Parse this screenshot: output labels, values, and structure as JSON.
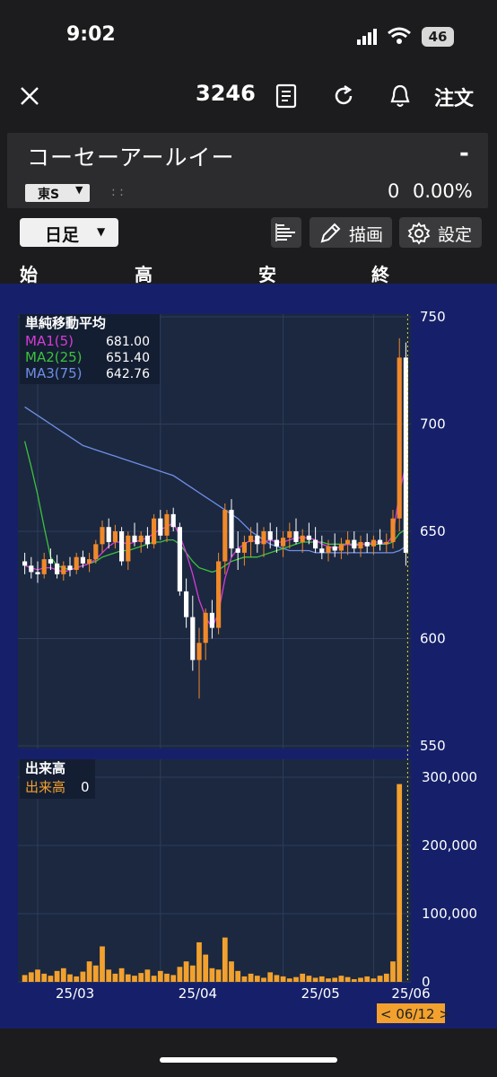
{
  "status_bar": {
    "time": "9:02",
    "battery": "46"
  },
  "nav": {
    "ticker": "3246",
    "order_label": "注文"
  },
  "header": {
    "company_name": "コーセーアールイー",
    "price": "-",
    "exchange": "東S",
    "time_placeholder": ": :",
    "change": "0",
    "change_pct": "0.00%"
  },
  "controls": {
    "period": "日足",
    "draw_label": "描画",
    "settings_label": "設定"
  },
  "ohlc_labels": {
    "open": "始",
    "high": "高",
    "low": "安",
    "close": "終"
  },
  "colors": {
    "chart_bg": "#16206a",
    "panel_bg": "#1b2840",
    "up": "#f0892a",
    "down": "#ffffff",
    "ma1": "#d63bd6",
    "ma2": "#3cc23c",
    "ma3": "#6f8fe6",
    "volume": "#f2a12e"
  },
  "chart_data": [
    {
      "type": "candlestick",
      "title": "単純移動平均",
      "legend": [
        {
          "name": "MA1(5)",
          "value": "681.00",
          "color": "#d63bd6"
        },
        {
          "name": "MA2(25)",
          "value": "651.40",
          "color": "#3cc23c"
        },
        {
          "name": "MA3(75)",
          "value": "642.76",
          "color": "#6f8fe6"
        }
      ],
      "y_ticks": [
        "750",
        "700",
        "650",
        "600",
        "550"
      ],
      "ylim": [
        550,
        750
      ],
      "x_ticks": [
        "25/03",
        "25/04",
        "25/05",
        "25/06"
      ],
      "candles": [
        [
          636,
          640,
          630,
          634
        ],
        [
          634,
          638,
          628,
          631
        ],
        [
          631,
          636,
          626,
          630
        ],
        [
          630,
          640,
          628,
          637
        ],
        [
          637,
          642,
          632,
          635
        ],
        [
          635,
          639,
          628,
          630
        ],
        [
          630,
          636,
          627,
          634
        ],
        [
          634,
          638,
          629,
          632
        ],
        [
          632,
          640,
          630,
          638
        ],
        [
          638,
          641,
          633,
          635
        ],
        [
          635,
          640,
          631,
          637
        ],
        [
          637,
          646,
          635,
          644
        ],
        [
          644,
          655,
          640,
          652
        ],
        [
          652,
          656,
          642,
          645
        ],
        [
          645,
          653,
          642,
          650
        ],
        [
          650,
          652,
          634,
          636
        ],
        [
          636,
          650,
          632,
          648
        ],
        [
          648,
          654,
          643,
          645
        ],
        [
          645,
          650,
          640,
          648
        ],
        [
          648,
          652,
          642,
          644
        ],
        [
          644,
          658,
          642,
          656
        ],
        [
          656,
          660,
          646,
          648
        ],
        [
          648,
          660,
          645,
          658
        ],
        [
          658,
          661,
          650,
          652
        ],
        [
          652,
          654,
          620,
          622
        ],
        [
          622,
          628,
          605,
          610
        ],
        [
          610,
          620,
          585,
          590
        ],
        [
          590,
          605,
          572,
          598
        ],
        [
          598,
          614,
          590,
          612
        ],
        [
          612,
          618,
          600,
          605
        ],
        [
          605,
          640,
          602,
          636
        ],
        [
          636,
          663,
          630,
          660
        ],
        [
          660,
          665,
          638,
          642
        ],
        [
          642,
          650,
          632,
          640
        ],
        [
          640,
          648,
          634,
          645
        ],
        [
          645,
          652,
          638,
          648
        ],
        [
          648,
          654,
          640,
          644
        ],
        [
          644,
          652,
          638,
          650
        ],
        [
          650,
          654,
          642,
          646
        ],
        [
          646,
          652,
          640,
          643
        ],
        [
          643,
          650,
          638,
          647
        ],
        [
          647,
          654,
          642,
          650
        ],
        [
          650,
          656,
          644,
          645
        ],
        [
          645,
          651,
          640,
          648
        ],
        [
          648,
          654,
          644,
          646
        ],
        [
          646,
          652,
          640,
          642
        ],
        [
          642,
          648,
          637,
          640
        ],
        [
          640,
          646,
          636,
          643
        ],
        [
          643,
          649,
          638,
          641
        ],
        [
          641,
          647,
          637,
          644
        ],
        [
          644,
          650,
          639,
          646
        ],
        [
          646,
          650,
          640,
          642
        ],
        [
          642,
          648,
          638,
          645
        ],
        [
          645,
          649,
          640,
          643
        ],
        [
          643,
          648,
          639,
          646
        ],
        [
          646,
          651,
          641,
          644
        ],
        [
          644,
          649,
          640,
          645
        ],
        [
          645,
          660,
          642,
          656
        ],
        [
          656,
          740,
          650,
          731
        ],
        [
          731,
          738,
          634,
          640
        ]
      ],
      "ma1": [
        634,
        633,
        632,
        633,
        633,
        632,
        631,
        632,
        633,
        634,
        635,
        637,
        640,
        643,
        645,
        645,
        644,
        645,
        646,
        647,
        649,
        651,
        652,
        654,
        648,
        640,
        630,
        618,
        610,
        605,
        612,
        628,
        638,
        642,
        644,
        646,
        645,
        645,
        646,
        645,
        645,
        646,
        647,
        647,
        647,
        646,
        644,
        643,
        642,
        643,
        644,
        643,
        644,
        644,
        645,
        645,
        644,
        648,
        668,
        681
      ],
      "ma2": [
        692,
        680,
        667,
        652,
        638,
        634,
        633,
        632,
        633,
        634,
        635,
        636,
        638,
        639,
        640,
        641,
        641,
        642,
        643,
        644,
        645,
        645,
        646,
        646,
        644,
        640,
        636,
        633,
        632,
        631,
        632,
        634,
        636,
        637,
        638,
        638,
        638,
        639,
        640,
        641,
        642,
        643,
        644,
        645,
        645,
        645,
        645,
        644,
        644,
        644,
        644,
        644,
        644,
        644,
        644,
        644,
        644,
        645,
        649,
        651
      ],
      "ma3": [
        708,
        706,
        704,
        702,
        700,
        698,
        696,
        694,
        692,
        690,
        689,
        688,
        687,
        686,
        685,
        684,
        683,
        682,
        681,
        680,
        679,
        678,
        677,
        676,
        674,
        672,
        670,
        668,
        666,
        664,
        662,
        660,
        658,
        656,
        653,
        650,
        648,
        646,
        644,
        643,
        642,
        641,
        641,
        641,
        641,
        640,
        640,
        640,
        640,
        640,
        640,
        640,
        640,
        640,
        640,
        640,
        640,
        640,
        641,
        643
      ]
    },
    {
      "type": "bar",
      "title": "出来高",
      "legend": [
        {
          "name": "出来高",
          "value": "0",
          "color": "#f2a12e"
        }
      ],
      "y_ticks": [
        "300,000",
        "200,000",
        "100,000",
        "0"
      ],
      "ylim": [
        0,
        300000
      ],
      "values": [
        10000,
        14000,
        18000,
        12000,
        9000,
        16000,
        20000,
        11000,
        8000,
        15000,
        30000,
        24000,
        52000,
        18000,
        12000,
        20000,
        11000,
        9000,
        13000,
        18000,
        9000,
        16000,
        12000,
        10000,
        22000,
        30000,
        24000,
        58000,
        40000,
        20000,
        18000,
        65000,
        30000,
        16000,
        8000,
        12000,
        9000,
        6000,
        14000,
        10000,
        8000,
        5000,
        7000,
        12000,
        9000,
        6000,
        8000,
        5000,
        6000,
        9000,
        7000,
        4000,
        6000,
        8000,
        5000,
        9000,
        12000,
        30000,
        290000,
        0
      ],
      "current_date_label": "< 06/12 >"
    }
  ]
}
